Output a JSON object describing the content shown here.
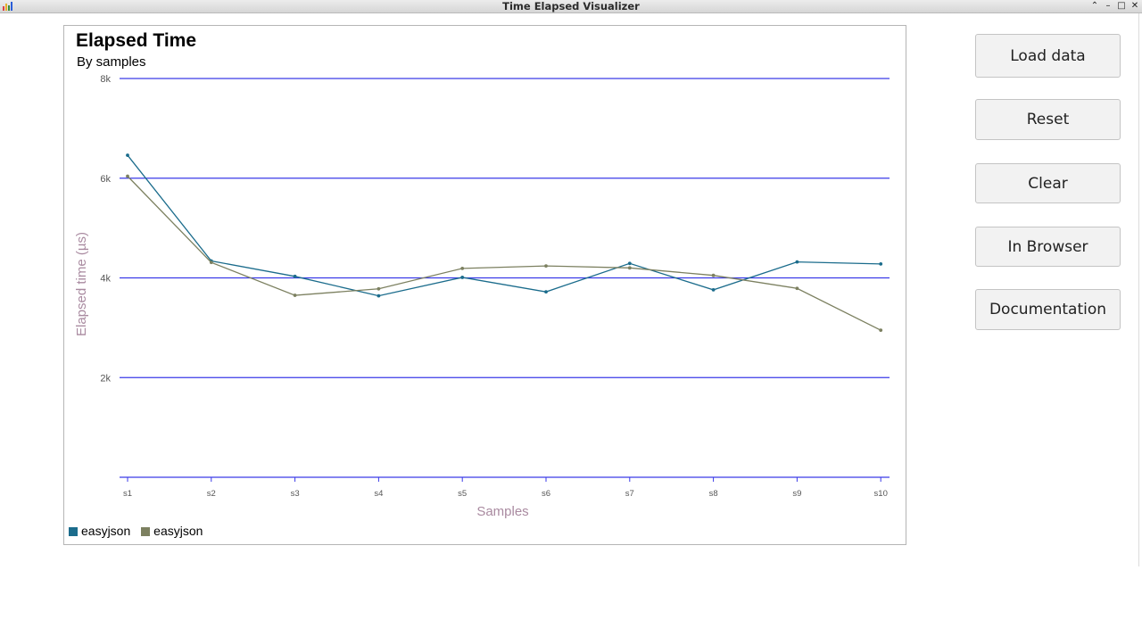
{
  "window": {
    "title": "Time Elapsed Visualizer",
    "controls": {
      "minimize": "⌃",
      "iconify": "–",
      "maximize": "□",
      "close": "✕"
    }
  },
  "sidebar": {
    "buttons": [
      {
        "id": "load-data",
        "label": "Load data"
      },
      {
        "id": "reset",
        "label": "Reset"
      },
      {
        "id": "clear",
        "label": "Clear"
      },
      {
        "id": "in-browser",
        "label": "In Browser"
      },
      {
        "id": "documentation",
        "label": "Documentation"
      }
    ]
  },
  "chart_data": {
    "type": "line",
    "title": "Elapsed Time",
    "subtitle": "By samples",
    "xlabel": "Samples",
    "ylabel": "Elapsed time (µs)",
    "categories": [
      "s1",
      "s2",
      "s3",
      "s4",
      "s5",
      "s6",
      "s7",
      "s8",
      "s9",
      "s10"
    ],
    "ylim": [
      0,
      8000
    ],
    "yticks": [
      2000,
      4000,
      6000,
      8000
    ],
    "ytick_labels": [
      "2k",
      "4k",
      "6k",
      "8k"
    ],
    "grid": true,
    "legend": "bottom-left",
    "series": [
      {
        "name": "easyjson",
        "color": "#1b6c8c",
        "values": [
          6460,
          4340,
          4030,
          3640,
          4010,
          3720,
          4290,
          3760,
          4320,
          4280
        ]
      },
      {
        "name": "easyjson",
        "color": "#7c8060",
        "values": [
          6040,
          4310,
          3650,
          3780,
          4190,
          4240,
          4200,
          4050,
          3790,
          2950
        ]
      }
    ],
    "gridline_color": "#3a3ae8",
    "label_color": "#a98aa0"
  }
}
